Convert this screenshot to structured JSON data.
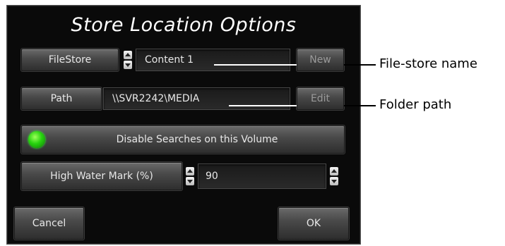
{
  "dialog": {
    "title": "Store Location Options",
    "filestore": {
      "button_label": "FileStore",
      "value": "Content 1",
      "new_label": "New"
    },
    "path": {
      "button_label": "Path",
      "value": "\\\\SVR2242\\MEDIA",
      "edit_label": "Edit"
    },
    "disable_searches": {
      "label": "Disable Searches on this Volume",
      "indicator_color": "#27d20f"
    },
    "high_water_mark": {
      "label": "High Water Mark (%)",
      "value": "90"
    },
    "cancel_label": "Cancel",
    "ok_label": "OK"
  },
  "annotations": {
    "filestore_name": "File-store name",
    "folder_path": "Folder path"
  }
}
